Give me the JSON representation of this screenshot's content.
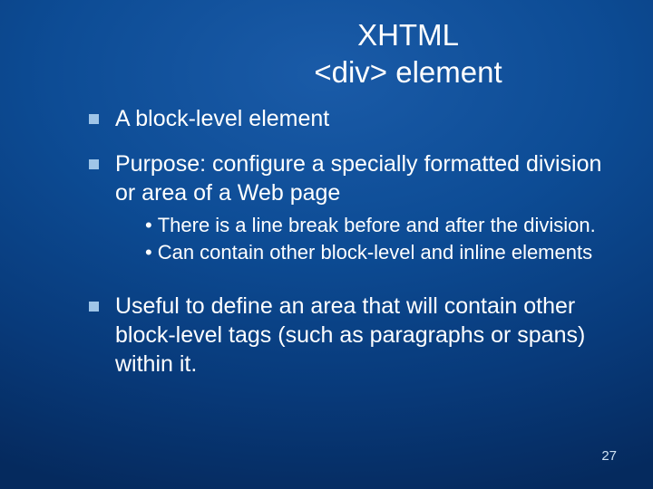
{
  "title_line1": "XHTML",
  "title_line2": "<div> element",
  "bullets": {
    "b1": "A block-level element",
    "b2": "Purpose: configure a specially formatted division or area of a Web page",
    "b3": "Useful to define an area that will contain other block-level tags (such as paragraphs or spans) within it."
  },
  "subs": {
    "s1": "There is a line break before and after the division.",
    "s2": "Can contain other block-level and inline elements"
  },
  "page_number": "27"
}
